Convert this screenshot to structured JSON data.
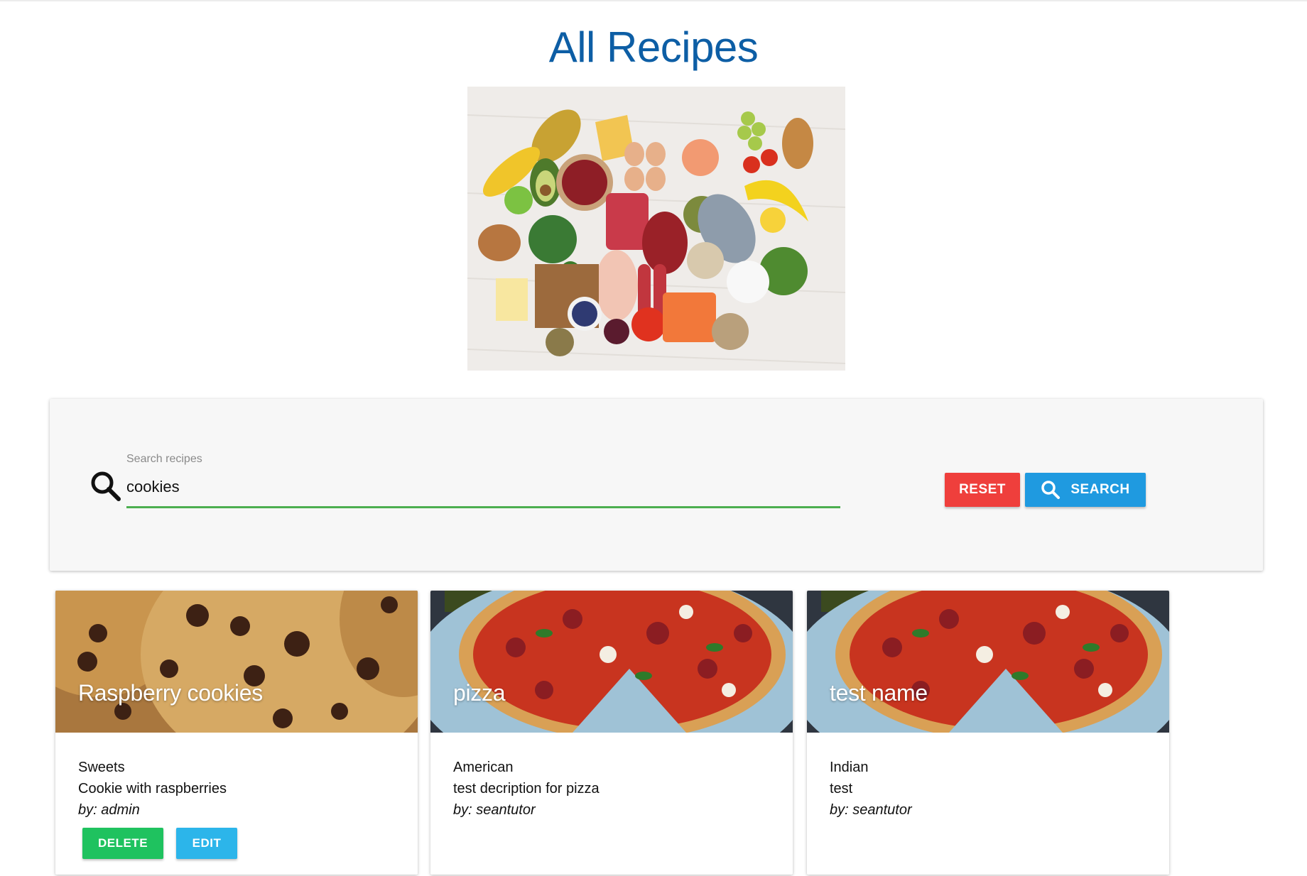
{
  "page": {
    "title": "All Recipes"
  },
  "search": {
    "label": "Search recipes",
    "value": "cookies",
    "underline_color": "#4caf50",
    "reset_label": "RESET",
    "search_label": "SEARCH"
  },
  "recipes": [
    {
      "name": "Raspberry cookies",
      "category": "Sweets",
      "description": "Cookie with raspberries",
      "author": "by: admin",
      "image": "chocolate-chip-cookies",
      "actions": {
        "delete_label": "DELETE",
        "edit_label": "EDIT"
      }
    },
    {
      "name": "pizza",
      "category": "American",
      "description": "test decription for pizza",
      "author": "by: seantutor",
      "image": "pepperoni-pizza"
    },
    {
      "name": "test name",
      "category": "Indian",
      "description": "test",
      "author": "by: seantutor",
      "image": "pepperoni-pizza"
    }
  ],
  "colors": {
    "title": "#0d5ea5",
    "reset": "#ef3f3c",
    "search": "#1f9ae0",
    "delete": "#1fc25f",
    "edit": "#2cb5ea"
  }
}
